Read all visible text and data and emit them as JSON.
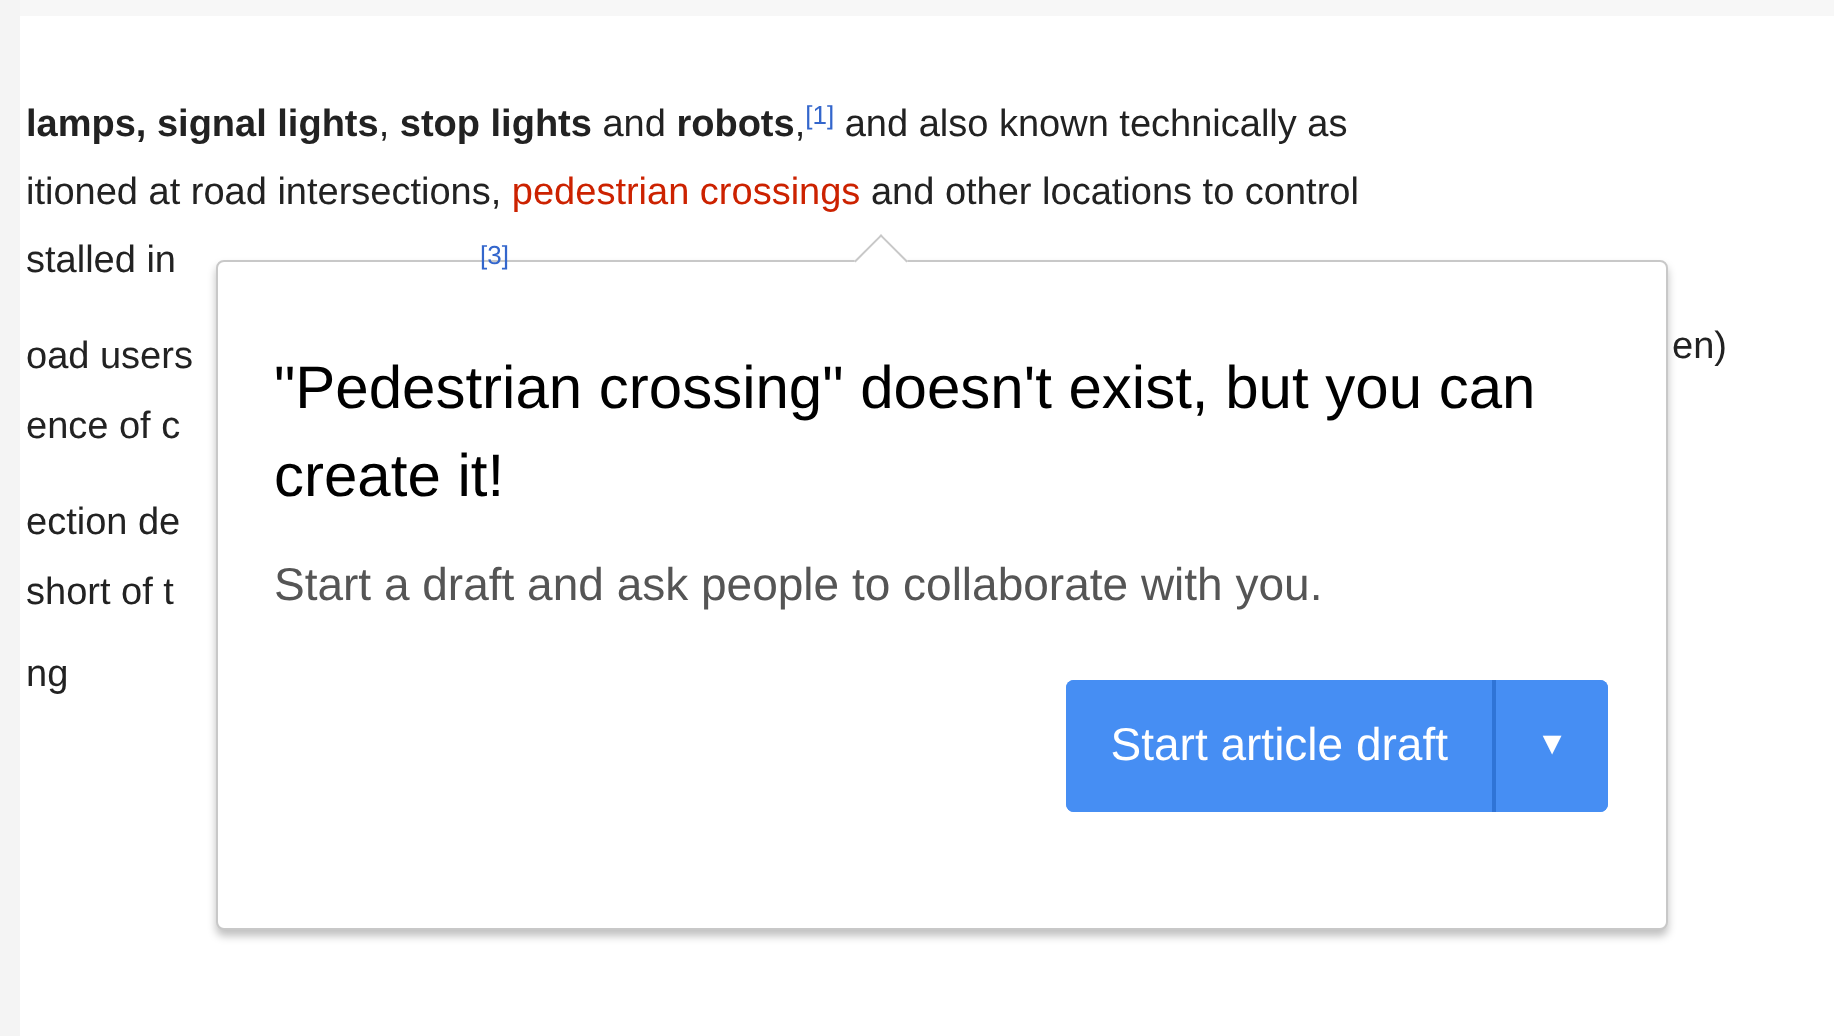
{
  "article": {
    "lines": [
      {
        "segments": [
          {
            "kind": "rich",
            "text": "**lamps, signal lights**, **stop lights** and **robots**,"
          },
          {
            "kind": "ref",
            "text": "[1]"
          },
          {
            "kind": "plain",
            "text": " and also known technically as"
          }
        ]
      },
      {
        "segments": [
          {
            "kind": "plain",
            "text": "itioned at road intersections, "
          },
          {
            "kind": "missing_link",
            "text": "pedestrian crossings"
          },
          {
            "kind": "plain",
            "text": " and other locations to control"
          }
        ]
      },
      {
        "segments": [
          {
            "kind": "plain",
            "text": "stalled in"
          },
          {
            "kind": "far_ref",
            "text": "[3]"
          }
        ]
      }
    ],
    "fragments": [
      "oad users",
      "ence of c",
      "ection de",
      "short of t",
      "ng"
    ],
    "right_fragment": "en)"
  },
  "popup": {
    "title": "\"Pedestrian crossing\" doesn't exist, but you can create it!",
    "message": "Start a draft and ask people to collaborate with you.",
    "button": {
      "label": "Start article draft",
      "menu_glyph": "▼"
    }
  }
}
